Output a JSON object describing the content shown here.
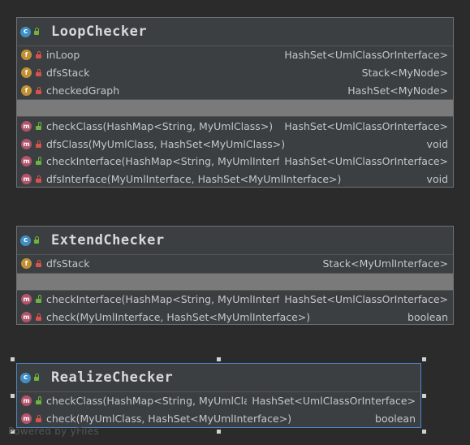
{
  "classes": [
    {
      "name": "LoopChecker",
      "icon": "class-icon",
      "fields": [
        {
          "kind": "f",
          "visibility": "private",
          "name": "inLoop",
          "type": "HashSet<UmlClassOrInterface>"
        },
        {
          "kind": "f",
          "visibility": "private",
          "name": "dfsStack",
          "type": "Stack<MyNode>"
        },
        {
          "kind": "f",
          "visibility": "private",
          "name": "checkedGraph",
          "type": "HashSet<MyNode>"
        }
      ],
      "methods": [
        {
          "kind": "m",
          "visibility": "public",
          "name": "checkClass(HashMap<String, MyUmlClass>)",
          "type": "HashSet<UmlClassOrInterface>"
        },
        {
          "kind": "m",
          "visibility": "private",
          "name": "dfsClass(MyUmlClass, HashSet<MyUmlClass>)",
          "type": "void"
        },
        {
          "kind": "m",
          "visibility": "public",
          "name": "checkInterface(HashMap<String, MyUmlInterface>)",
          "type": "HashSet<UmlClassOrInterface>"
        },
        {
          "kind": "m",
          "visibility": "private",
          "name": "dfsInterface(MyUmlInterface, HashSet<MyUmlInterface>)",
          "type": "void"
        }
      ]
    },
    {
      "name": "ExtendChecker",
      "icon": "class-icon",
      "fields": [
        {
          "kind": "f",
          "visibility": "private",
          "name": "dfsStack",
          "type": "Stack<MyUmlInterface>"
        }
      ],
      "methods": [
        {
          "kind": "m",
          "visibility": "public",
          "name": "checkInterface(HashMap<String, MyUmlInterface>)",
          "type": "HashSet<UmlClassOrInterface>"
        },
        {
          "kind": "m",
          "visibility": "private",
          "name": "check(MyUmlInterface, HashSet<MyUmlInterface>)",
          "type": "boolean"
        }
      ]
    },
    {
      "name": "RealizeChecker",
      "icon": "class-icon",
      "fields": [],
      "methods": [
        {
          "kind": "m",
          "visibility": "public",
          "name": "checkClass(HashMap<String, MyUmlClass>)",
          "type": "HashSet<UmlClassOrInterface>"
        },
        {
          "kind": "m",
          "visibility": "private",
          "name": "check(MyUmlClass, HashSet<MyUmlInterface>)",
          "type": "boolean"
        }
      ]
    }
  ],
  "watermark": "Powered by yFiles"
}
